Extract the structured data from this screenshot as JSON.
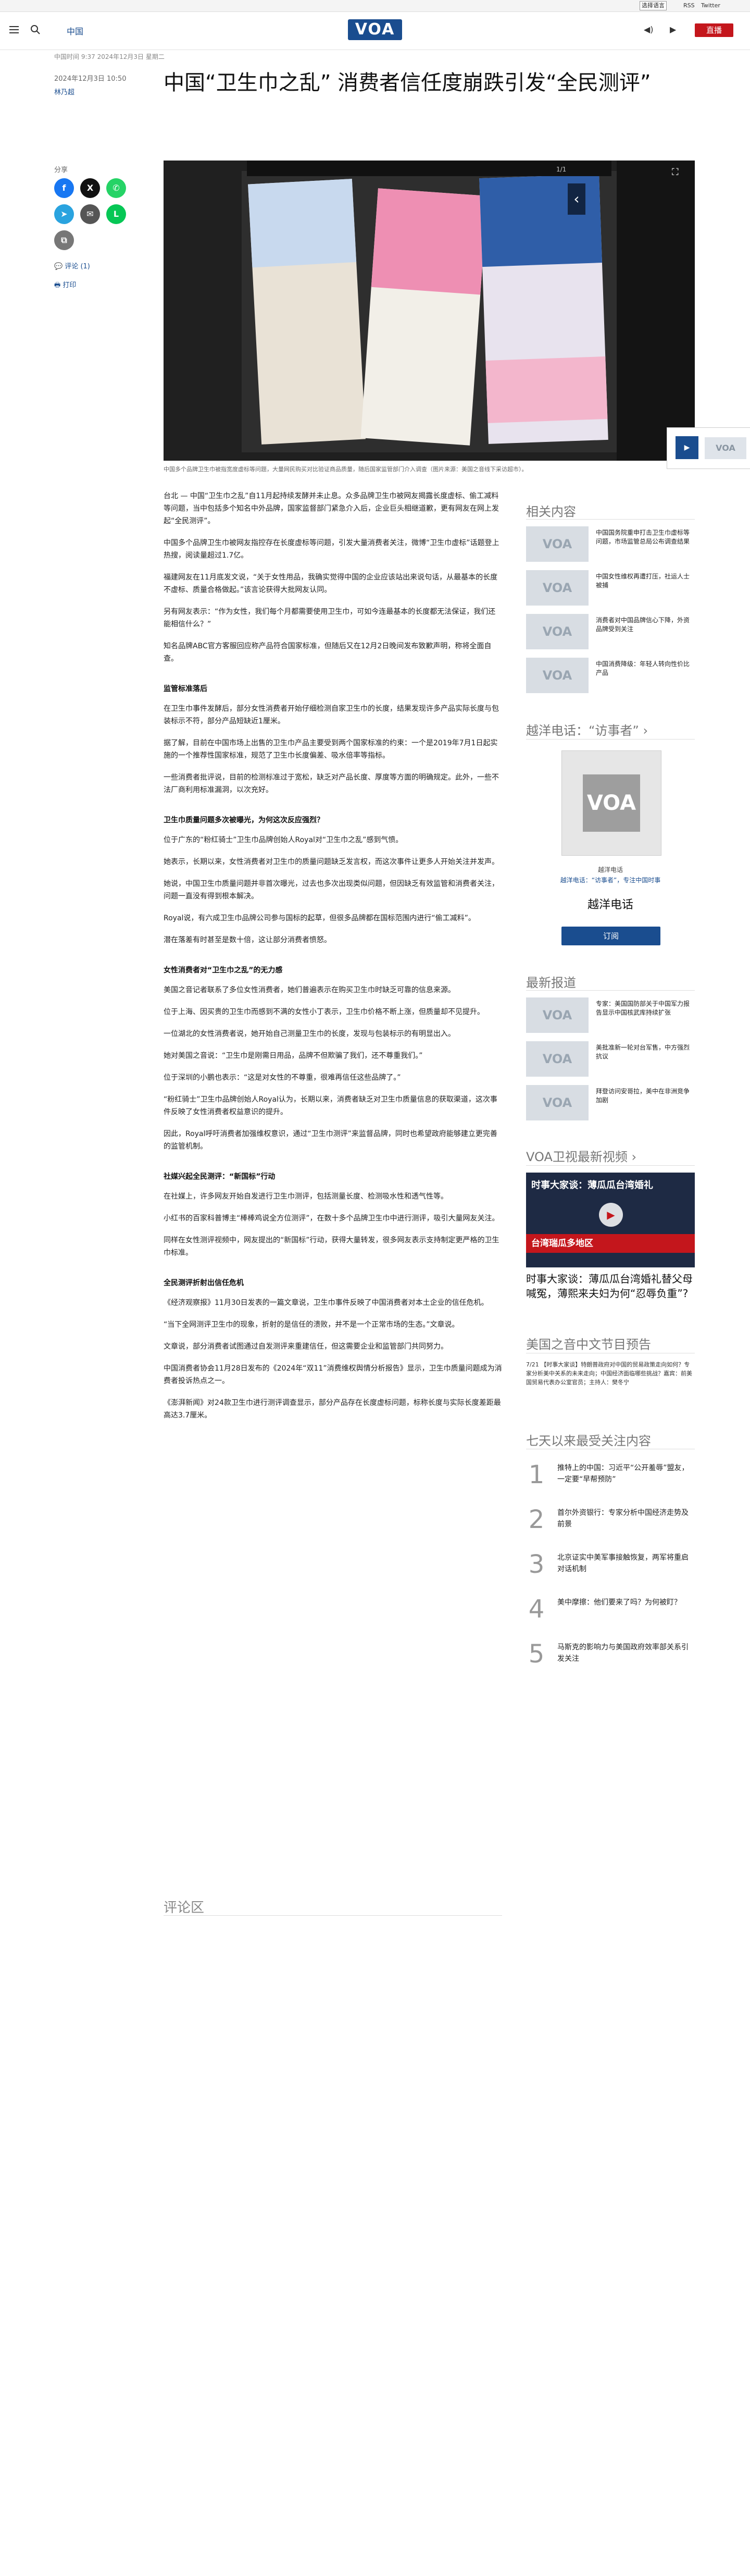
{
  "utility": {
    "language_select": "选择语言",
    "link1": "RSS",
    "link2": "Twitter"
  },
  "header": {
    "section": "中国",
    "logo": "VOA",
    "audio": "◀)",
    "video": "▶",
    "live": "直播"
  },
  "article": {
    "breadcrumb": "中国时间 9:37 2024年12月3日 星期二",
    "dateline": "2024年12月3日 10:50",
    "author": "林乃超",
    "title": "中国“卫生巾之乱” 消费者信任度崩跌引发“全民测评”",
    "share_label": "分享",
    "comment_link": "评论 (1)",
    "print_link": "打印",
    "hero_counter": "1/1",
    "caption": "中国多个品牌卫生巾被指宽度虚标等问题，大量网民购买对比验证商品质量，随后国家监管部门介入调查（图片来源：美国之音线下采访超市）。"
  },
  "body": [
    {
      "type": "p",
      "text": "台北 — 中国“卫生巾之乱”自11月起持续发酵并未止息。众多品牌卫生巾被网友揭露长度虚标、偷工减料等问题，当中包括多个知名中外品牌，国家监督部门紧急介入后，企业巨头相继道歉，更有网友在网上发起“全民测评”。"
    },
    {
      "type": "p",
      "text": "中国多个品牌卫生巾被网友指控存在长度虚标等问题，引发大量消费者关注，微博“卫生巾虚标”话题登上热搜，阅读量超过1.7亿。"
    },
    {
      "type": "p",
      "text": "福建网友在11月底发文说，“关于女性用品，我确实觉得中国的企业应该站出来说句话，从最基本的长度不虚标、质量合格做起。”该言论获得大批网友认同。"
    },
    {
      "type": "p",
      "text": "另有网友表示：“作为女性，我们每个月都需要使用卫生巾，可如今连最基本的长度都无法保证，我们还能相信什么？”"
    },
    {
      "type": "p",
      "text": "知名品牌ABC官方客服回应称产品符合国家标准，但随后又在12月2日晚间发布致歉声明，称将全面自查。"
    },
    {
      "type": "h",
      "text": "监管标准落后"
    },
    {
      "type": "p",
      "text": "在卫生巾事件发酵后，部分女性消费者开始仔细检测自家卫生巾的长度，结果发现许多产品实际长度与包装标示不符，部分产品短缺近1厘米。"
    },
    {
      "type": "p",
      "text": "据了解，目前在中国市场上出售的卫生巾产品主要受到两个国家标准的约束：一个是2019年7月1日起实施的一个推荐性国家标准，规范了卫生巾长度偏差、吸水倍率等指标。"
    },
    {
      "type": "p",
      "text": "一些消费者批评说，目前的检测标准过于宽松，缺乏对产品长度、厚度等方面的明确规定。此外，一些不法厂商利用标准漏洞，以次充好。"
    },
    {
      "type": "h",
      "text": "卫生巾质量问题多次被曝光，为何这次反应强烈？"
    },
    {
      "type": "p",
      "text": "位于广东的“粉红骑士”卫生巾品牌创始人Royal对“卫生巾之乱”感到气愤。"
    },
    {
      "type": "p",
      "text": "她表示，长期以来，女性消费者对卫生巾的质量问题缺乏发言权，而这次事件让更多人开始关注并发声。"
    },
    {
      "type": "p",
      "text": "她说，中国卫生巾质量问题并非首次曝光，过去也多次出现类似问题，但因缺乏有效监管和消费者关注，问题一直没有得到根本解决。"
    },
    {
      "type": "p",
      "text": "Royal说，有六成卫生巾品牌公司参与国标的起草，但很多品牌都在国标范围内进行“偷工减料”。"
    },
    {
      "type": "p",
      "text": "潜在落差有时甚至是数十倍，这让部分消费者愤怒。"
    },
    {
      "type": "h",
      "text": "女性消费者对“卫生巾之乱”的无力感"
    },
    {
      "type": "p",
      "text": "美国之音记者联系了多位女性消费者，她们普遍表示在购买卫生巾时缺乏可靠的信息来源。"
    },
    {
      "type": "p",
      "text": "位于上海、因买贵的卫生巾而感到不满的女性小丁表示，卫生巾价格不断上涨，但质量却不见提升。"
    },
    {
      "type": "p",
      "text": "一位湖北的女性消费者说，她开始自己测量卫生巾的长度，发现与包装标示的有明显出入。"
    },
    {
      "type": "p",
      "text": "她对美国之音说：“卫生巾是刚需日用品，品牌不但欺骗了我们，还不尊重我们。”"
    },
    {
      "type": "p",
      "text": "位于深圳的小鹏也表示：“这是对女性的不尊重，很难再信任这些品牌了。”"
    },
    {
      "type": "p",
      "text": "“粉红骑士”卫生巾品牌创始人Royal认为，长期以来，消费者缺乏对卫生巾质量信息的获取渠道，这次事件反映了女性消费者权益意识的提升。"
    },
    {
      "type": "p",
      "text": "因此，Royal呼吁消费者加强维权意识，通过“卫生巾测评”来监督品牌，同时也希望政府能够建立更完善的监管机制。"
    },
    {
      "type": "h",
      "text": "社媒兴起全民测评：“新国标”行动"
    },
    {
      "type": "p",
      "text": "在社媒上，许多网友开始自发进行卫生巾测评，包括测量长度、检测吸水性和透气性等。"
    },
    {
      "type": "p",
      "text": "小红书的百家科普博主“棒棒鸡说全方位测评”，在数十多个品牌卫生巾中进行测评，吸引大量网友关注。"
    },
    {
      "type": "p",
      "text": "同样在女性测评视频中，网友提出的“新国标”行动，获得大量转发，很多网友表示支持制定更严格的卫生巾标准。"
    },
    {
      "type": "h",
      "text": "全民测评折射出信任危机"
    },
    {
      "type": "p",
      "text": "《经济观察报》11月30日发表的一篇文章说，卫生巾事件反映了中国消费者对本土企业的信任危机。"
    },
    {
      "type": "p",
      "text": "“当下全网测评卫生巾的现象，折射的是信任的溃败，并不是一个正常市场的生态。”文章说。"
    },
    {
      "type": "p",
      "text": "文章说，部分消费者试图通过自发测评来重建信任，但这需要企业和监管部门共同努力。"
    },
    {
      "type": "p",
      "text": "中国消费者协会11月28日发布的《2024年“双11”消费维权舆情分析报告》显示，卫生巾质量问题成为消费者投诉热点之一。"
    },
    {
      "type": "p",
      "text": "《澎湃新闻》对24款卫生巾进行测评调查显示，部分产品存在长度虚标问题，标称长度与实际长度差距最高达3.7厘米。"
    }
  ],
  "comments_heading": "评论区",
  "sidebar": {
    "related_title": "相关内容",
    "related": [
      {
        "thumb": "VOA",
        "text": "中国国务院重申打击卫生巾虚标等问题，市场监管总局公布调查结果"
      },
      {
        "thumb": "VOA",
        "text": "中国女性维权再遭打压，社运人士被捕"
      },
      {
        "thumb": "VOA",
        "text": "消费者对中国品牌信心下降，外资品牌受到关注"
      },
      {
        "thumb": "VOA",
        "text": "中国消费降级：年轻人转向性价比产品"
      }
    ],
    "cs_title": "越洋电话：“访事者”",
    "cs_label": "越洋电话",
    "cs_sub": "越洋电话：“访事者”，专注中国时事",
    "cs_name": "越洋电话",
    "cs_button": "订阅",
    "news_title": "最新报道",
    "news": [
      {
        "thumb": "VOA",
        "text": "专家：美国国防部关于中国军力报告显示中国核武库持续扩张"
      },
      {
        "thumb": "VOA",
        "text": "美批准新一轮对台军售，中方强烈抗议"
      },
      {
        "thumb": "VOA",
        "text": "拜登访问安哥拉，美中在非洲竞争加剧"
      }
    ],
    "video_title_head": "VOA卫视最新视频",
    "video_overlay": "台湾瑞瓜多地区",
    "video_label": "时事大家谈：薄瓜瓜台湾婚礼",
    "video_title": "时事大家谈：薄瓜瓜台湾婚礼替父母喊冤，薄熙来夫妇为何“忍辱负重”?",
    "preview_title": "美国之音中文节目预告",
    "preview_text": "7/21 【时事大家谈】特朗普政府对中国的贸易政策走向如何？专家分析美中关系的未来走向；中国经济面临哪些挑战？嘉宾：前美国贸易代表办公室官员；主持人：樊冬宁",
    "ranking_title": "七天以来最受关注内容",
    "ranking": [
      {
        "n": "1",
        "text": "推特上的中国：习近平“公开羞辱”盟友，一定要“早帮预防”"
      },
      {
        "n": "2",
        "text": "首尔外资银行：专家分析中国经济走势及前景"
      },
      {
        "n": "3",
        "text": "北京证实中美军事接触恢复，两军将重启对话机制"
      },
      {
        "n": "4",
        "text": "美中摩擦：他们要来了吗？为何被盯？"
      },
      {
        "n": "5",
        "text": "马斯克的影响力与美国政府效率部关系引发关注"
      }
    ]
  }
}
